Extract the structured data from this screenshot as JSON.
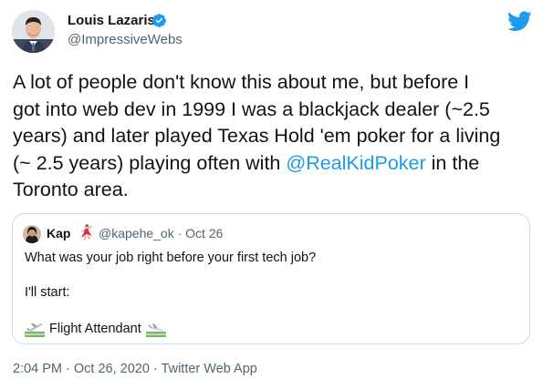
{
  "author": {
    "name": "Louis Lazaris",
    "handle": "@ImpressiveWebs"
  },
  "tweet": {
    "line1": "A lot of people don't know this about me, but before I",
    "line2": "got into web dev in 1999 I was a blackjack dealer (~2.5",
    "line3": "years) and later played Texas Hold 'em poker for a living",
    "line4_pre": "(~ 2.5 years) playing often with ",
    "mention": "@RealKidPoker",
    "line4_post": " in the",
    "line5": "Toronto area."
  },
  "quote": {
    "name": "Kap",
    "handle": "@kapehe_ok",
    "separator": " · ",
    "date": "Oct 26",
    "line1": "What was your job right before your first tech job?",
    "line2": "I'll start:",
    "line3": "Flight Attendant"
  },
  "meta": {
    "time": "2:04 PM",
    "separator": " · ",
    "date": "Oct 26, 2020",
    "source": "Twitter Web App"
  },
  "colors": {
    "link": "#1d9bf0",
    "secondary_text": "#536471",
    "border": "#cfd9de",
    "verified": "#1d9bf0"
  },
  "icons": {
    "verified": "verified-badge-icon",
    "logo": "twitter-bird-icon",
    "quote_emoji": "woman-dancing-emoji",
    "flight_emoji": "airplane-departure-emoji"
  }
}
